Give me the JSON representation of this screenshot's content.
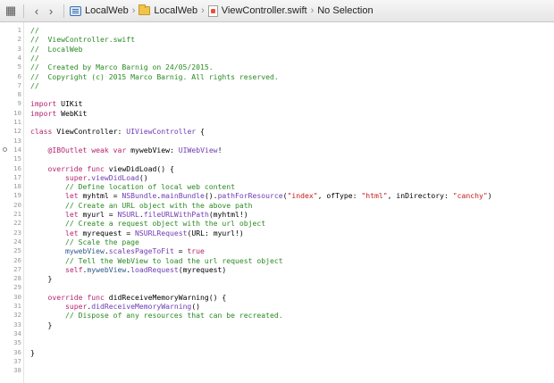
{
  "jumpbar": {
    "crumbs": [
      "LocalWeb",
      "LocalWeb",
      "ViewController.swift",
      "No Selection"
    ]
  },
  "code_lines": [
    {
      "n": "1",
      "html": "<span class=\"c\">//</span>"
    },
    {
      "n": "2",
      "html": "<span class=\"c\">//  ViewController.swift</span>"
    },
    {
      "n": "3",
      "html": "<span class=\"c\">//  LocalWeb</span>"
    },
    {
      "n": "4",
      "html": "<span class=\"c\">//</span>"
    },
    {
      "n": "5",
      "html": "<span class=\"c\">//  Created by Marco Barnig on 24/05/2015.</span>"
    },
    {
      "n": "6",
      "html": "<span class=\"c\">//  Copyright (c) 2015 Marco Barnig. All rights reserved.</span>"
    },
    {
      "n": "7",
      "html": "<span class=\"c\">//</span>"
    },
    {
      "n": "8",
      "html": ""
    },
    {
      "n": "9",
      "html": "<span class=\"k\">import</span> UIKit"
    },
    {
      "n": "10",
      "html": "<span class=\"k\">import</span> WebKit"
    },
    {
      "n": "11",
      "html": ""
    },
    {
      "n": "12",
      "html": "<span class=\"k\">class</span> ViewController: <span class=\"t\">UIViewController</span> {"
    },
    {
      "n": "13",
      "html": ""
    },
    {
      "n": "14",
      "html": "    <span class=\"k\">@IBOutlet weak var</span> mywebView: <span class=\"t\">UIWebView</span>!"
    },
    {
      "n": "15",
      "html": ""
    },
    {
      "n": "16",
      "html": "    <span class=\"k\">override func</span> viewDidLoad() {"
    },
    {
      "n": "17",
      "html": "        <span class=\"k\">super</span>.<span class=\"t\">viewDidLoad</span>()"
    },
    {
      "n": "18",
      "html": "        <span class=\"c\">// Define location of local web content</span>"
    },
    {
      "n": "19",
      "html": "        <span class=\"k\">let</span> myhtml = <span class=\"t\">NSBundle</span>.<span class=\"t\">mainBundle</span>().<span class=\"t\">pathForResource</span>(<span class=\"s\">\"index\"</span>, ofType: <span class=\"s\">\"html\"</span>, inDirectory: <span class=\"s\">\"canchy\"</span>)"
    },
    {
      "n": "20",
      "html": "        <span class=\"c\">// Create an URL object with the above path</span>"
    },
    {
      "n": "21",
      "html": "        <span class=\"k\">let</span> myurl = <span class=\"t\">NSURL</span>.<span class=\"t\">fileURLWithPath</span>(myhtml!)"
    },
    {
      "n": "22",
      "html": "        <span class=\"c\">// Create a request object with the url object</span>"
    },
    {
      "n": "23",
      "html": "        <span class=\"k\">let</span> myrequest = <span class=\"t\">NSURLRequest</span>(URL: myurl!)"
    },
    {
      "n": "24",
      "html": "        <span class=\"c\">// Scale the page</span>"
    },
    {
      "n": "25",
      "html": "        <span class=\"m\">mywebView</span>.<span class=\"t\">scalesPageToFit</span> = <span class=\"k\">true</span>"
    },
    {
      "n": "26",
      "html": "        <span class=\"c\">// Tell the WebView to load the url request object</span>"
    },
    {
      "n": "27",
      "html": "        <span class=\"k\">self</span>.<span class=\"m\">mywebView</span>.<span class=\"t\">loadRequest</span>(myrequest)"
    },
    {
      "n": "28",
      "html": "    }"
    },
    {
      "n": "29",
      "html": ""
    },
    {
      "n": "30",
      "html": "    <span class=\"k\">override func</span> didReceiveMemoryWarning() {"
    },
    {
      "n": "31",
      "html": "        <span class=\"k\">super</span>.<span class=\"t\">didReceiveMemoryWarning</span>()"
    },
    {
      "n": "32",
      "html": "        <span class=\"c\">// Dispose of any resources that can be recreated.</span>"
    },
    {
      "n": "33",
      "html": "    }"
    },
    {
      "n": "34",
      "html": ""
    },
    {
      "n": "35",
      "html": ""
    },
    {
      "n": "36",
      "html": "}"
    },
    {
      "n": "37",
      "html": ""
    },
    {
      "n": "38",
      "html": ""
    }
  ]
}
